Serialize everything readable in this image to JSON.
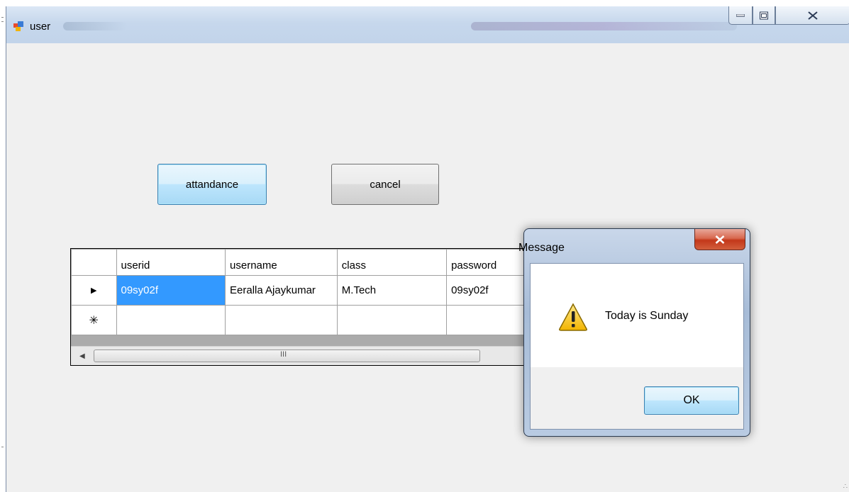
{
  "window": {
    "title": "user",
    "colors": {
      "titlebar": "#c6d7ec",
      "client": "#f0f0f0"
    }
  },
  "buttons": {
    "attendance_label": "attandance",
    "cancel_label": "cancel"
  },
  "grid": {
    "columns": [
      "userid",
      "username",
      "class",
      "password"
    ],
    "rows": [
      {
        "marker": "▶",
        "userid": "09sy02f",
        "username": "Eeralla  Ajaykumar",
        "class": "M.Tech",
        "password": "09sy02f"
      },
      {
        "marker": "✳",
        "userid": "",
        "username": "",
        "class": "",
        "password": ""
      }
    ],
    "scroll_grip": "III"
  },
  "dialog": {
    "title": "Message",
    "message": "Today is Sunday",
    "ok_label": "OK",
    "icon": "warning-icon"
  }
}
